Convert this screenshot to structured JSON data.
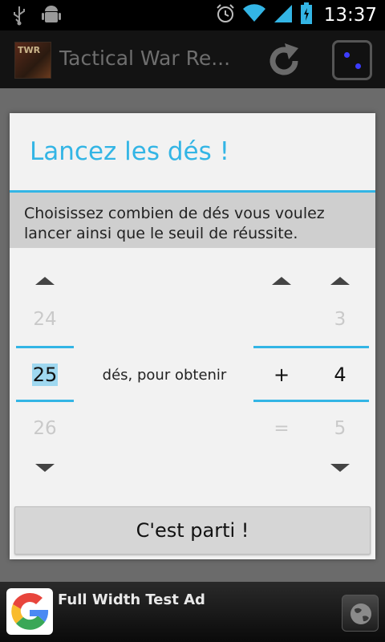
{
  "status_bar": {
    "time": "13:37",
    "icons": [
      "usb-icon",
      "android-debug-icon",
      "alarm-icon",
      "wifi-icon",
      "signal-icon",
      "battery-charging-icon"
    ]
  },
  "action_bar": {
    "title": "Tactical War Re...",
    "app_icon_text": "TWR",
    "actions": [
      "refresh-icon",
      "dice-icon"
    ]
  },
  "dialog": {
    "title": "Lancez les dés !",
    "message": "Choisissez combien de dés vous voulez lancer ainsi que le seuil de réussite.",
    "dice_picker": {
      "prev": "24",
      "current": "25",
      "next": "26"
    },
    "middle_label": "dés, pour obtenir",
    "sign_picker": {
      "prev": "",
      "current": "+",
      "next": "="
    },
    "threshold_picker": {
      "prev": "3",
      "current": "4",
      "next": "5"
    },
    "button_label": "C'est parti !"
  },
  "ad": {
    "text": "Full Width Test Ad"
  },
  "colors": {
    "accent": "#33b5e5",
    "dialog_bg": "#f2f2f2",
    "message_bg": "#cfcfcf",
    "dim_overlay": "#6b6b6b"
  }
}
